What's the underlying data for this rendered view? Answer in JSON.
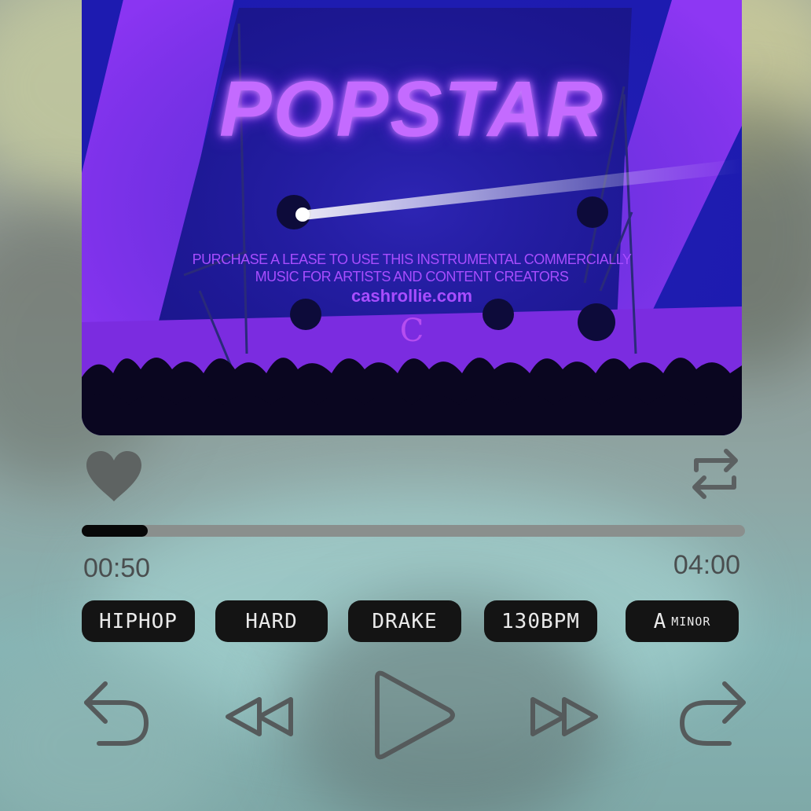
{
  "cover": {
    "title": "POPSTAR",
    "line1": "PURCHASE A LEASE TO USE THIS INSTRUMENTAL COMMERCIALLY",
    "line2": "MUSIC FOR ARTISTS AND CONTENT CREATORS",
    "website": "cashrollie.com",
    "logo_letter": "C"
  },
  "player": {
    "liked": true,
    "repeat": true,
    "progress": {
      "current": "00:50",
      "duration": "04:00",
      "fraction": 0.1
    }
  },
  "tags": [
    {
      "label": "HIPHOP"
    },
    {
      "label": "HARD"
    },
    {
      "label": "DRAKE"
    },
    {
      "label": "130BPM"
    },
    {
      "label": "A",
      "suffix": "MINOR"
    }
  ],
  "controls": [
    "undo-icon",
    "rewind-icon",
    "play-icon",
    "fast-forward-icon",
    "redo-icon"
  ],
  "colors": {
    "cover_blue": "#1c1aa8",
    "cover_purple": "#9a39ff",
    "title_glow": "#c46bff",
    "tag_bg": "#141414",
    "control_gray": "#555a5b"
  }
}
